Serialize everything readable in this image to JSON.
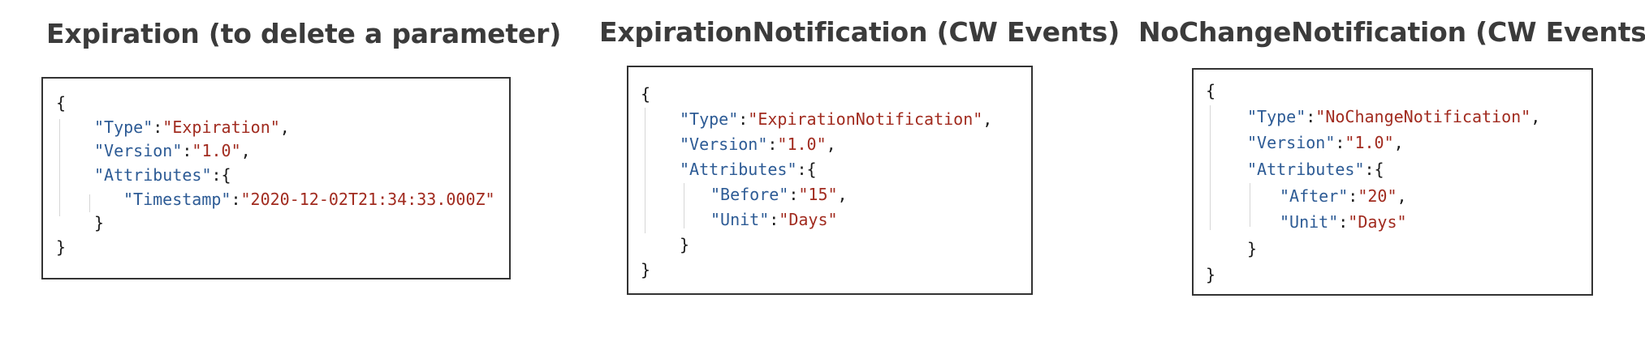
{
  "panels": [
    {
      "title": "Expiration (to delete a parameter)",
      "open_brace": "{",
      "type_key": "\"Type\"",
      "type_value": "\"Expiration\"",
      "version_key": "\"Version\"",
      "version_value": "\"1.0\"",
      "attributes_key": "\"Attributes\"",
      "attr1_key": "\"Timestamp\"",
      "attr1_value": "\"2020-12-02T21:34:33.000Z\"",
      "inner_close": "}",
      "close_brace": "}"
    },
    {
      "title": "ExpirationNotification (CW Events)",
      "open_brace": "{",
      "type_key": "\"Type\"",
      "type_value": "\"ExpirationNotification\"",
      "version_key": "\"Version\"",
      "version_value": "\"1.0\"",
      "attributes_key": "\"Attributes\"",
      "attr1_key": "\"Before\"",
      "attr1_value": "\"15\"",
      "attr2_key": "\"Unit\"",
      "attr2_value": "\"Days\"",
      "inner_close": "}",
      "close_brace": "}"
    },
    {
      "title": "NoChangeNotification (CW Events)",
      "open_brace": "{",
      "type_key": "\"Type\"",
      "type_value": "\"NoChangeNotification\"",
      "version_key": "\"Version\"",
      "version_value": "\"1.0\"",
      "attributes_key": "\"Attributes\"",
      "attr1_key": "\"After\"",
      "attr1_value": "\"20\"",
      "attr2_key": "\"Unit\"",
      "attr2_value": "\"Days\"",
      "inner_close": "}",
      "close_brace": "}"
    }
  ]
}
